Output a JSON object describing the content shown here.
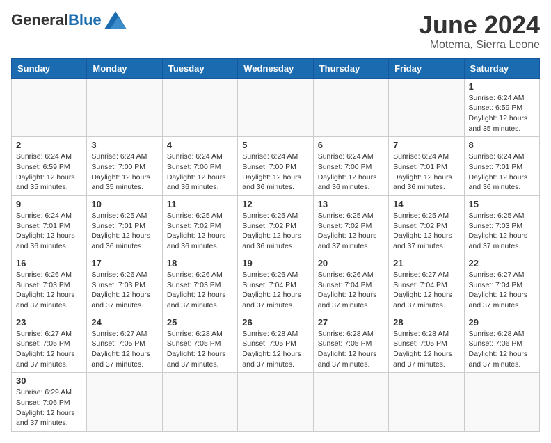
{
  "header": {
    "logo_general": "General",
    "logo_blue": "Blue",
    "month_title": "June 2024",
    "subtitle": "Motema, Sierra Leone"
  },
  "weekdays": [
    "Sunday",
    "Monday",
    "Tuesday",
    "Wednesday",
    "Thursday",
    "Friday",
    "Saturday"
  ],
  "days": {
    "1": {
      "sunrise": "6:24 AM",
      "sunset": "6:59 PM",
      "daylight": "12 hours and 35 minutes."
    },
    "2": {
      "sunrise": "6:24 AM",
      "sunset": "6:59 PM",
      "daylight": "12 hours and 35 minutes."
    },
    "3": {
      "sunrise": "6:24 AM",
      "sunset": "7:00 PM",
      "daylight": "12 hours and 35 minutes."
    },
    "4": {
      "sunrise": "6:24 AM",
      "sunset": "7:00 PM",
      "daylight": "12 hours and 36 minutes."
    },
    "5": {
      "sunrise": "6:24 AM",
      "sunset": "7:00 PM",
      "daylight": "12 hours and 36 minutes."
    },
    "6": {
      "sunrise": "6:24 AM",
      "sunset": "7:00 PM",
      "daylight": "12 hours and 36 minutes."
    },
    "7": {
      "sunrise": "6:24 AM",
      "sunset": "7:01 PM",
      "daylight": "12 hours and 36 minutes."
    },
    "8": {
      "sunrise": "6:24 AM",
      "sunset": "7:01 PM",
      "daylight": "12 hours and 36 minutes."
    },
    "9": {
      "sunrise": "6:24 AM",
      "sunset": "7:01 PM",
      "daylight": "12 hours and 36 minutes."
    },
    "10": {
      "sunrise": "6:25 AM",
      "sunset": "7:01 PM",
      "daylight": "12 hours and 36 minutes."
    },
    "11": {
      "sunrise": "6:25 AM",
      "sunset": "7:02 PM",
      "daylight": "12 hours and 36 minutes."
    },
    "12": {
      "sunrise": "6:25 AM",
      "sunset": "7:02 PM",
      "daylight": "12 hours and 36 minutes."
    },
    "13": {
      "sunrise": "6:25 AM",
      "sunset": "7:02 PM",
      "daylight": "12 hours and 37 minutes."
    },
    "14": {
      "sunrise": "6:25 AM",
      "sunset": "7:02 PM",
      "daylight": "12 hours and 37 minutes."
    },
    "15": {
      "sunrise": "6:25 AM",
      "sunset": "7:03 PM",
      "daylight": "12 hours and 37 minutes."
    },
    "16": {
      "sunrise": "6:26 AM",
      "sunset": "7:03 PM",
      "daylight": "12 hours and 37 minutes."
    },
    "17": {
      "sunrise": "6:26 AM",
      "sunset": "7:03 PM",
      "daylight": "12 hours and 37 minutes."
    },
    "18": {
      "sunrise": "6:26 AM",
      "sunset": "7:03 PM",
      "daylight": "12 hours and 37 minutes."
    },
    "19": {
      "sunrise": "6:26 AM",
      "sunset": "7:04 PM",
      "daylight": "12 hours and 37 minutes."
    },
    "20": {
      "sunrise": "6:26 AM",
      "sunset": "7:04 PM",
      "daylight": "12 hours and 37 minutes."
    },
    "21": {
      "sunrise": "6:27 AM",
      "sunset": "7:04 PM",
      "daylight": "12 hours and 37 minutes."
    },
    "22": {
      "sunrise": "6:27 AM",
      "sunset": "7:04 PM",
      "daylight": "12 hours and 37 minutes."
    },
    "23": {
      "sunrise": "6:27 AM",
      "sunset": "7:05 PM",
      "daylight": "12 hours and 37 minutes."
    },
    "24": {
      "sunrise": "6:27 AM",
      "sunset": "7:05 PM",
      "daylight": "12 hours and 37 minutes."
    },
    "25": {
      "sunrise": "6:28 AM",
      "sunset": "7:05 PM",
      "daylight": "12 hours and 37 minutes."
    },
    "26": {
      "sunrise": "6:28 AM",
      "sunset": "7:05 PM",
      "daylight": "12 hours and 37 minutes."
    },
    "27": {
      "sunrise": "6:28 AM",
      "sunset": "7:05 PM",
      "daylight": "12 hours and 37 minutes."
    },
    "28": {
      "sunrise": "6:28 AM",
      "sunset": "7:05 PM",
      "daylight": "12 hours and 37 minutes."
    },
    "29": {
      "sunrise": "6:28 AM",
      "sunset": "7:06 PM",
      "daylight": "12 hours and 37 minutes."
    },
    "30": {
      "sunrise": "6:29 AM",
      "sunset": "7:06 PM",
      "daylight": "12 hours and 37 minutes."
    }
  }
}
